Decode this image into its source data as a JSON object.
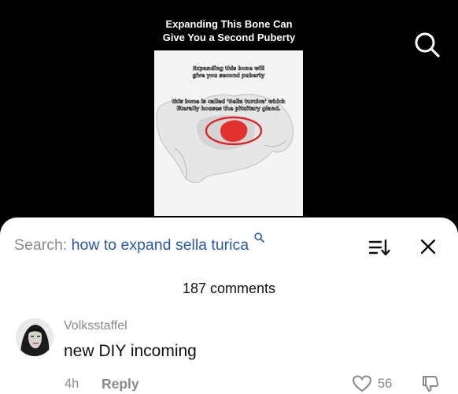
{
  "video": {
    "title_line1": "Expanding This Bone Can",
    "title_line2": "Give You a Second Puberty",
    "thumbnail": {
      "caption1_line1": "Expanding this bone will",
      "caption1_line2": "give you second puberty",
      "caption2_line1": "this bone is called 'Sella turcica' which",
      "caption2_line2": "literally houses the pituitary gland."
    },
    "search_icon": "search-icon"
  },
  "comments_sheet": {
    "search_label": "Search:",
    "search_query": "how to expand sella turica",
    "sort_icon": "sort-icon",
    "close_icon": "close-icon",
    "count_label": "187 comments",
    "comments": [
      {
        "username": "Volksstaffel",
        "text": "new DIY incoming",
        "time": "4h",
        "reply_label": "Reply",
        "likes": "56"
      }
    ]
  },
  "colors": {
    "query_blue": "#2b59a4",
    "muted_gray": "#8a8a8a",
    "background": "#000000",
    "sheet": "#ffffff"
  }
}
